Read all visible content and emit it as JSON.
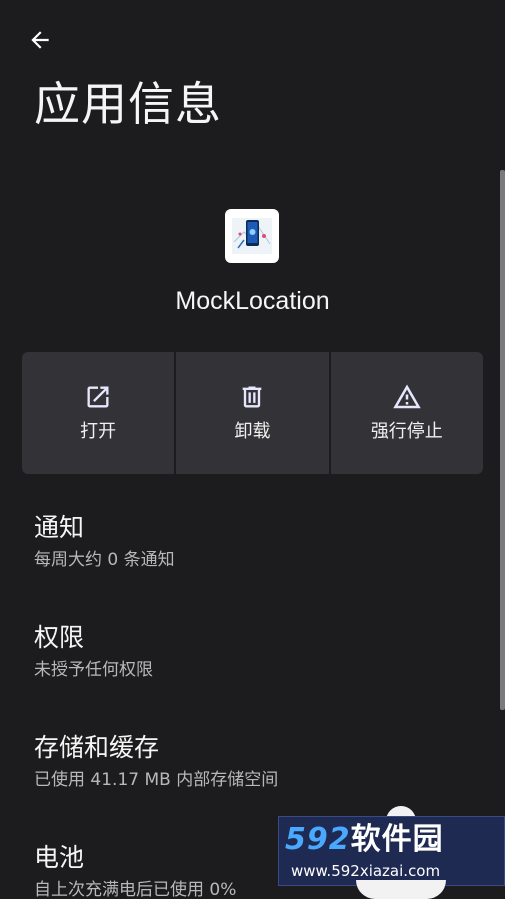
{
  "header": {
    "back_icon": "arrow-left-icon",
    "title": "应用信息"
  },
  "app": {
    "name": "MockLocation",
    "icon": "app-icon"
  },
  "actions": [
    {
      "label": "打开",
      "icon": "open-external-icon"
    },
    {
      "label": "卸载",
      "icon": "trash-icon"
    },
    {
      "label": "强行停止",
      "icon": "warning-icon"
    }
  ],
  "settings": [
    {
      "title": "通知",
      "subtitle": "每周大约 0 条通知"
    },
    {
      "title": "权限",
      "subtitle": "未授予任何权限"
    },
    {
      "title": "存储和缓存",
      "subtitle": "已使用 41.17 MB 内部存储空间"
    },
    {
      "title": "电池",
      "subtitle": "自上次充满电后已使用 0%"
    }
  ],
  "watermark": {
    "brand_num": "592",
    "brand_cn": "软件园",
    "url": "www.592xiazai.com"
  },
  "colors": {
    "background": "#1c1b1d",
    "button_bg": "#333236",
    "text_primary": "#f5f5f5",
    "text_secondary": "#b8b8ba"
  }
}
